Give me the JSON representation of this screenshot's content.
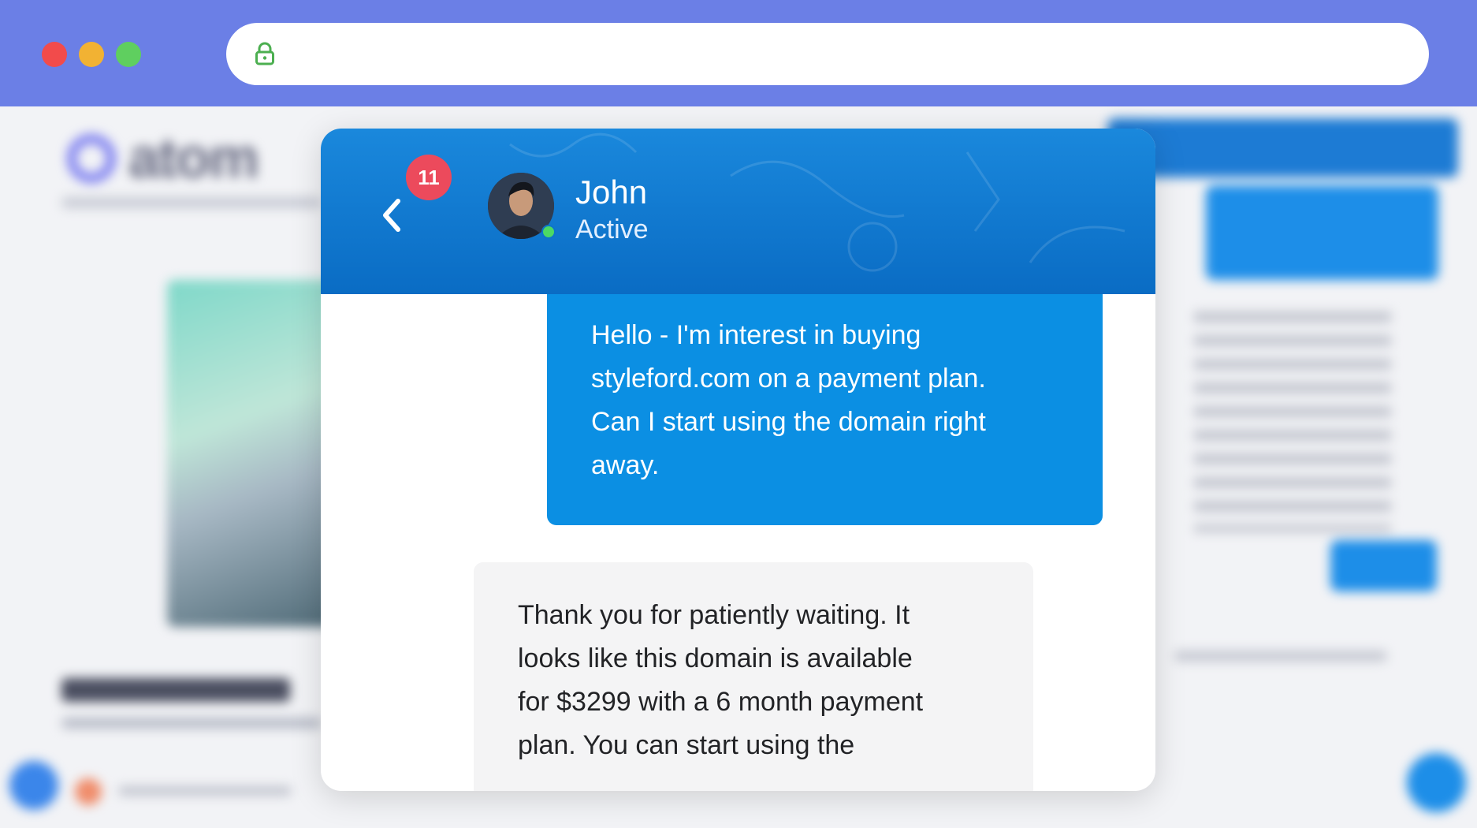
{
  "browser": {
    "url": "",
    "icons": {
      "lock": "lock-icon"
    },
    "colors": {
      "chrome": "#6b7fe6",
      "close": "#f24b4b",
      "minimize": "#f2b233",
      "maximize": "#5fcf5f"
    }
  },
  "background": {
    "logo_text": "atom"
  },
  "chat": {
    "unread_count": "11",
    "contact": {
      "name": "John",
      "status": "Active"
    },
    "icons": {
      "back": "chevron-left-icon",
      "online": "online-status-dot"
    },
    "messages": [
      {
        "direction": "outgoing",
        "text": "Hello - I'm interest in buying\nstyleford.com on a payment plan.\nCan I start using the domain right\naway."
      },
      {
        "direction": "incoming",
        "text": "Thank you for patiently waiting. It\nlooks like this domain is available\nfor $3299 with a 6 month payment\nplan. You can start using the"
      }
    ],
    "colors": {
      "header": "#0a6cc4",
      "outgoing_bubble": "#0b8fe3",
      "incoming_bubble": "#f4f4f5",
      "badge": "#ec4a5c",
      "online": "#4cd964"
    }
  }
}
